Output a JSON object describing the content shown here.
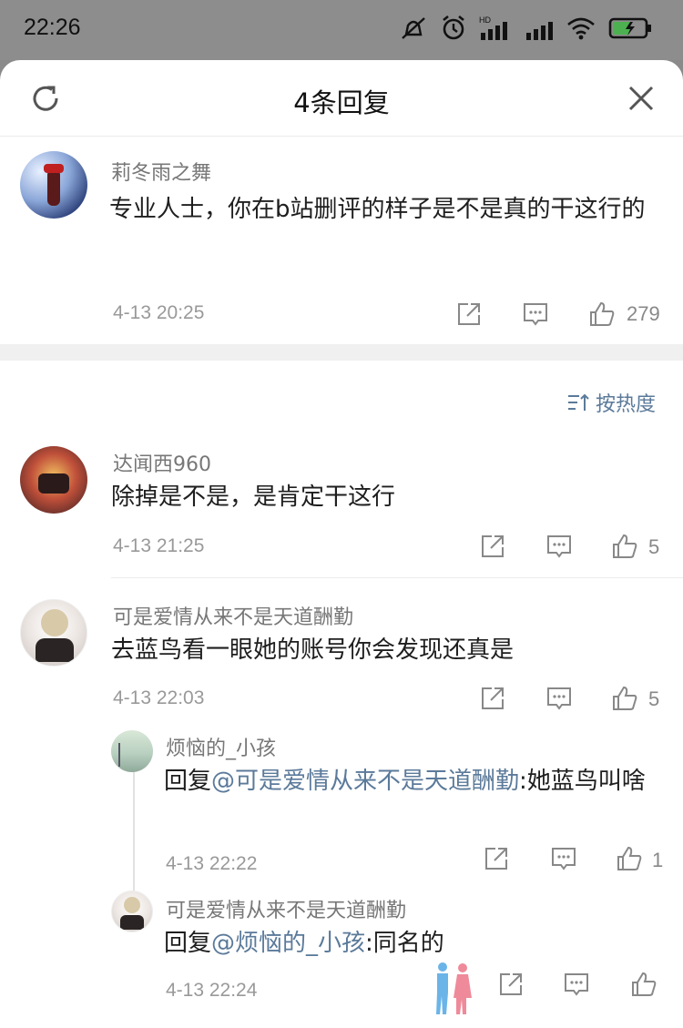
{
  "status_bar": {
    "time": "22:26",
    "icons": [
      "mute-icon",
      "alarm-icon",
      "hd-signal-icon",
      "signal-icon",
      "wifi-icon",
      "battery-charging-icon"
    ],
    "hd_label": "HD"
  },
  "header": {
    "title": "4条回复",
    "refresh_icon": "refresh-icon",
    "close_icon": "close-icon"
  },
  "root_comment": {
    "username": "莉冬雨之舞",
    "text": "专业人士，你在b站删评的样子是不是真的干这行的",
    "date": "4-13 20:25",
    "likes": "279"
  },
  "sort": {
    "label": "按热度",
    "icon": "sort-icon"
  },
  "replies": [
    {
      "username": "达闻西960",
      "text": "除掉是不是，是肯定干这行",
      "date": "4-13 21:25",
      "likes": "5"
    },
    {
      "username": "可是爱情从来不是天道酬勤",
      "text": "去蓝鸟看一眼她的账号你会发现还真是",
      "date": "4-13 22:03",
      "likes": "5"
    }
  ],
  "sub_replies": [
    {
      "username": "烦恼的_小孩",
      "prefix": "回复",
      "mention": "@可是爱情从来不是天道酬勤",
      "text": ":她蓝鸟叫啥",
      "date": "4-13 22:22",
      "likes": "1"
    },
    {
      "username": "可是爱情从来不是天道酬勤",
      "prefix": "回复",
      "mention": "@烦恼的_小孩",
      "text": ":同名的",
      "date": "4-13 22:24",
      "likes": ""
    }
  ],
  "colors": {
    "mention": "#5b7a9a",
    "divider_band": "#f0f0f0",
    "status_bar": "#8d8d8d"
  }
}
